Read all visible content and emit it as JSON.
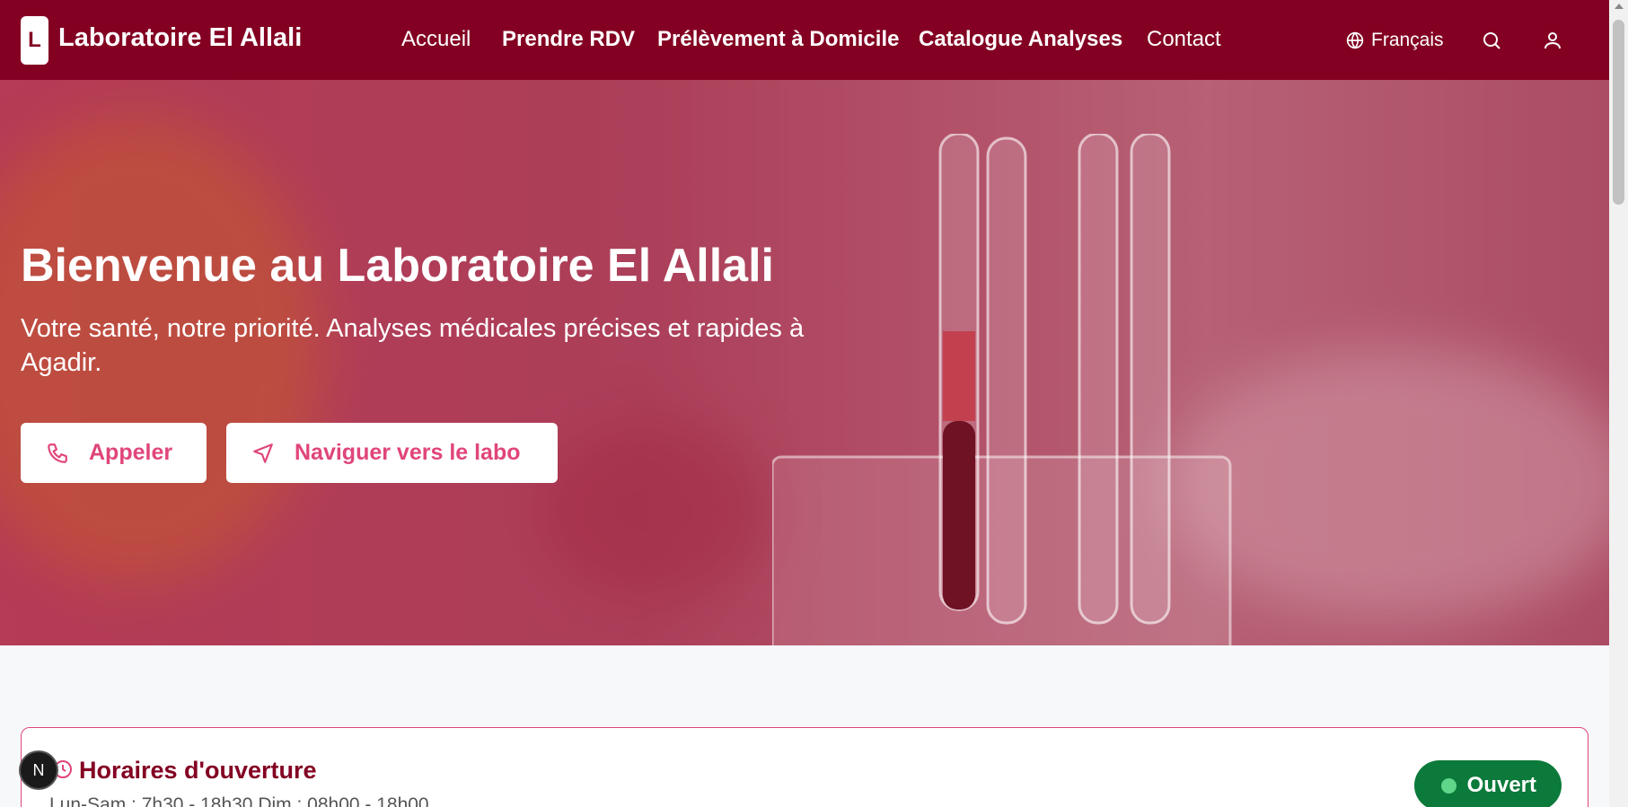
{
  "header": {
    "logo_letter": "L",
    "brand": "Laboratoire El Allali",
    "nav": [
      "Accueil",
      "Prendre RDV",
      "Prélèvement à Domicile",
      "Catalogue Analyses",
      "Contact"
    ],
    "language": "Français"
  },
  "hero": {
    "title": "Bienvenue au Laboratoire El Allali",
    "subtitle": "Votre santé, notre priorité. Analyses médicales précises et rapides à Agadir.",
    "call_label": "Appeler",
    "navigate_label": "Naviguer vers le labo"
  },
  "hours": {
    "title": "Horaires d'ouverture",
    "text": "Lun-Sam : 7h30 - 18h30 Dim : 08h00 - 18h00",
    "status": "Ouvert"
  },
  "dev_badge": "N",
  "colors": {
    "brand": "#830022",
    "accent": "#e0457b",
    "open": "#0b7a3a"
  }
}
